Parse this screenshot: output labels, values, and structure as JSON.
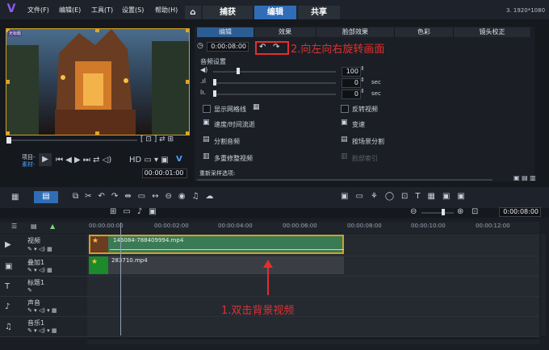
{
  "menu": {
    "file": "文件(F)",
    "edit": "编辑(E)",
    "tools": "工具(T)",
    "settings": "设置(S)",
    "help": "帮助(H)"
  },
  "main_tabs": {
    "capture": "捕获",
    "edit": "编辑",
    "share": "共享"
  },
  "resolution": "3. 1920*1080",
  "preview": {
    "badge": "无标题",
    "project_label": "项目-",
    "clip_label": "素材-",
    "timecode": "00:00:01:00"
  },
  "edit_panel": {
    "tabs": [
      "编辑",
      "效果",
      "脸部效果",
      "色彩",
      "镜头校正"
    ],
    "duration": "0:00:08:00",
    "audio_title": "音频设置",
    "volume": "100",
    "fade_in": "0",
    "fade_out": "0",
    "sec_unit": "sec",
    "options": {
      "show_grid": "显示网格线",
      "reverse": "反转视频",
      "speed_lapse": "速度/时间流逝",
      "speed": "变速",
      "split_audio": "分割音频",
      "scene_split": "按场景分割",
      "multi_trim": "多重修整视频",
      "face_index": "脸部索引"
    },
    "resample": "重新采样选项:"
  },
  "annotations": {
    "rotate": "2.向左向右旋转画面",
    "double_click": "1.双击背景视频"
  },
  "zoom_timecode": "0:00:08:00",
  "ruler": [
    "00:00:00:00",
    "00:00:02:00",
    "00:00:04:00",
    "00:00:06:00",
    "00:00:08:00",
    "00:00:10:00",
    "00:00:12:00"
  ],
  "tracks": {
    "video": "视频",
    "overlay": "叠加1",
    "title": "标题1",
    "voice": "声音",
    "music": "音乐1"
  },
  "clips": {
    "video": "146084-788409994.mp4",
    "overlay": "283710.mp4"
  },
  "colors": {
    "accent": "#2f6eb7",
    "clip_green": "#3a7a55",
    "selection": "#d2a020",
    "annotation": "#e03030"
  }
}
